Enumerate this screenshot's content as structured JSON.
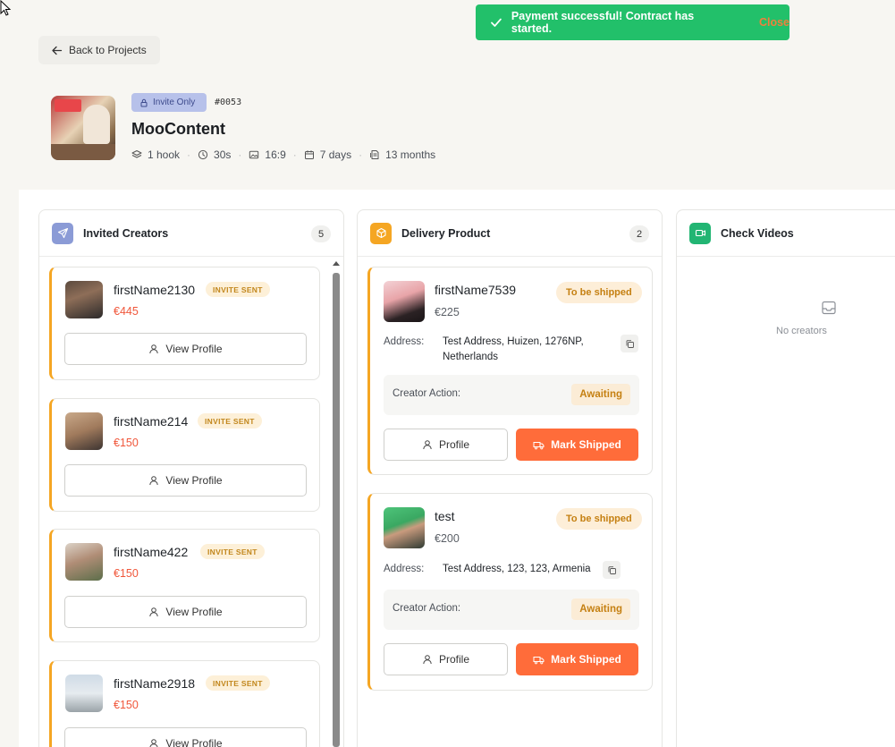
{
  "toast": {
    "message": "Payment successful! Contract has started.",
    "close_label": "Close"
  },
  "back_label": "Back to Projects",
  "project": {
    "badge": "Invite Only",
    "id": "#0053",
    "title": "MooContent",
    "meta": [
      "1 hook",
      "30s",
      "16:9",
      "7 days",
      "13 months"
    ]
  },
  "columns": {
    "invited": {
      "title": "Invited Creators",
      "count": "5",
      "cards": [
        {
          "name": "firstName2130",
          "price": "€445",
          "badge": "INVITE SENT",
          "button": "View Profile"
        },
        {
          "name": "firstName214",
          "price": "€150",
          "badge": "INVITE SENT",
          "button": "View Profile"
        },
        {
          "name": "firstName422",
          "price": "€150",
          "badge": "INVITE SENT",
          "button": "View Profile"
        },
        {
          "name": "firstName2918",
          "price": "€150",
          "badge": "INVITE SENT",
          "button": "View Profile"
        }
      ]
    },
    "delivery": {
      "title": "Delivery Product",
      "count": "2",
      "cards": [
        {
          "name": "firstName7539",
          "price": "€225",
          "status": "To be shipped",
          "address_label": "Address:",
          "address": "Test Address, Huizen, 1276NP, Netherlands",
          "action_label": "Creator Action:",
          "action_status": "Awaiting",
          "profile_label": "Profile",
          "ship_label": "Mark Shipped"
        },
        {
          "name": "test",
          "price": "€200",
          "status": "To be shipped",
          "address_label": "Address:",
          "address": "Test Address, 123, 123, Armenia",
          "action_label": "Creator Action:",
          "action_status": "Awaiting",
          "profile_label": "Profile",
          "ship_label": "Mark Shipped"
        }
      ]
    },
    "check": {
      "title": "Check Videos",
      "empty": "No creators"
    }
  },
  "colors": {
    "toast_green": "#22c06a",
    "accent_orange": "#ff6c3a",
    "price_red": "#f0563a",
    "invited_icon": "#8b9bd6",
    "delivery_icon": "#f5a623",
    "check_icon": "#22b573"
  },
  "icons": {
    "toast": "check-icon",
    "back": "arrow-left-icon",
    "invite_badge": "lock-icon",
    "meta": [
      "layers-icon",
      "clock-icon",
      "image-icon",
      "calendar-icon",
      "contract-icon"
    ],
    "invited": "send-icon",
    "delivery": "box-icon",
    "check": "video-icon",
    "empty": "inbox-icon"
  }
}
